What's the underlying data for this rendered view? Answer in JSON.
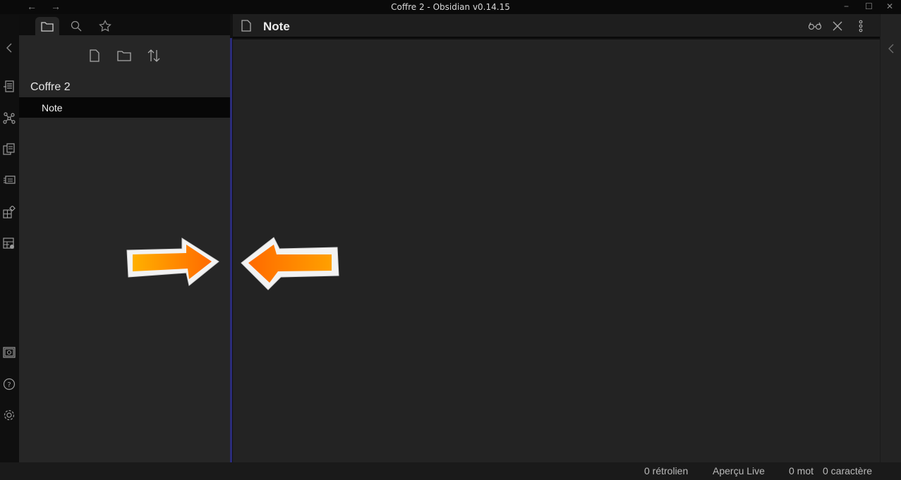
{
  "window": {
    "title": "Coffre 2 - Obsidian v0.14.15",
    "back_glyph": "←",
    "forward_glyph": "→",
    "minimize_glyph": "−",
    "maximize_glyph": "☐",
    "close_glyph": "✕"
  },
  "left_sidebar": {
    "tabs": [
      "folder-icon",
      "search-icon",
      "star-icon"
    ],
    "toolbar": [
      "new-note-icon",
      "new-folder-icon",
      "sort-icon"
    ],
    "vault_name": "Coffre 2",
    "files": [
      {
        "label": "Note",
        "selected": true
      }
    ]
  },
  "ribbon": {
    "icons": [
      "collapse-chevron-icon",
      "outline-icon",
      "graph-icon",
      "templates-icon",
      "slides-icon",
      "grid-icon",
      "table-icon",
      "vault-icon",
      "help-icon",
      "settings-icon"
    ]
  },
  "editor": {
    "tab_title": "Note",
    "actions": [
      "reading-view-icon",
      "close-icon",
      "more-options-icon"
    ]
  },
  "status_bar": {
    "backlinks": "0 rétrolien",
    "mode": "Aperçu Live",
    "words": "0 mot",
    "characters": "0 caractère"
  },
  "colors": {
    "accent_divider": "#2b2c7a",
    "arrow_orange": "#ff8a00"
  },
  "annotations": [
    "arrow-right-icon",
    "arrow-left-icon"
  ]
}
